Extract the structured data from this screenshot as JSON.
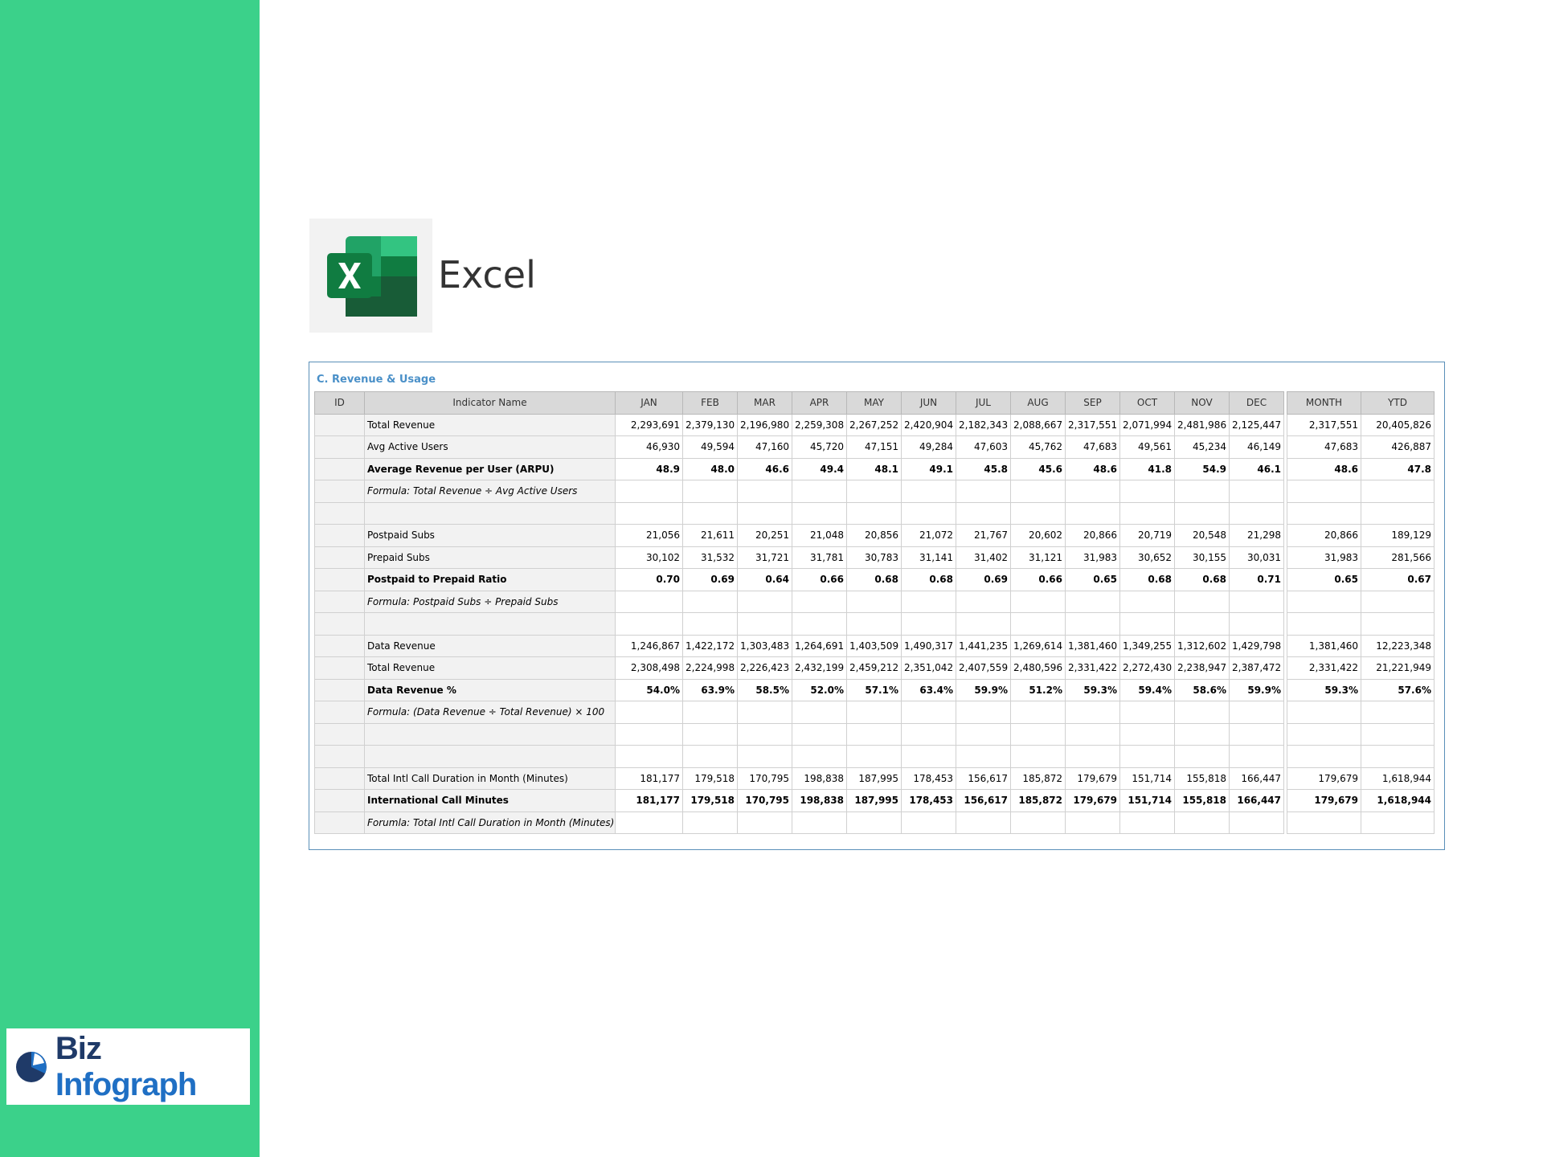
{
  "app": {
    "title": "Excel"
  },
  "brand": {
    "part1": "Biz",
    "part2": "Infograph"
  },
  "colors": {
    "sidebar": "#3bd18a",
    "accent": "#4a90c8",
    "excel_green": "#107c41"
  },
  "sheet": {
    "title": "C. Revenue & Usage",
    "headers": {
      "id": "ID",
      "name": "Indicator Name",
      "months": [
        "JAN",
        "FEB",
        "MAR",
        "APR",
        "MAY",
        "JUN",
        "JUL",
        "AUG",
        "SEP",
        "OCT",
        "NOV",
        "DEC"
      ],
      "month": "MONTH",
      "ytd": "YTD"
    },
    "rows": [
      {
        "id": "",
        "name": "Total Revenue",
        "style": "normal",
        "values": [
          "2,293,691",
          "2,379,130",
          "2,196,980",
          "2,259,308",
          "2,267,252",
          "2,420,904",
          "2,182,343",
          "2,088,667",
          "2,317,551",
          "2,071,994",
          "2,481,986",
          "2,125,447"
        ],
        "month": "2,317,551",
        "ytd": "20,405,826"
      },
      {
        "id": "",
        "name": "Avg Active Users",
        "style": "normal",
        "values": [
          "46,930",
          "49,594",
          "47,160",
          "45,720",
          "47,151",
          "49,284",
          "47,603",
          "45,762",
          "47,683",
          "49,561",
          "45,234",
          "46,149"
        ],
        "month": "47,683",
        "ytd": "426,887"
      },
      {
        "id": "",
        "name": "Average Revenue per User (ARPU)",
        "style": "bold",
        "values": [
          "48.9",
          "48.0",
          "46.6",
          "49.4",
          "48.1",
          "49.1",
          "45.8",
          "45.6",
          "48.6",
          "41.8",
          "54.9",
          "46.1"
        ],
        "month": "48.6",
        "ytd": "47.8"
      },
      {
        "id": "",
        "name": "Formula: Total Revenue ÷ Avg Active Users",
        "style": "italic",
        "values": [
          "",
          "",
          "",
          "",
          "",
          "",
          "",
          "",
          "",
          "",
          "",
          ""
        ],
        "month": "",
        "ytd": ""
      },
      {
        "id": "",
        "name": "",
        "style": "normal",
        "values": [
          "",
          "",
          "",
          "",
          "",
          "",
          "",
          "",
          "",
          "",
          "",
          ""
        ],
        "month": "",
        "ytd": ""
      },
      {
        "id": "",
        "name": "Postpaid Subs",
        "style": "normal",
        "values": [
          "21,056",
          "21,611",
          "20,251",
          "21,048",
          "20,856",
          "21,072",
          "21,767",
          "20,602",
          "20,866",
          "20,719",
          "20,548",
          "21,298"
        ],
        "month": "20,866",
        "ytd": "189,129"
      },
      {
        "id": "",
        "name": "Prepaid Subs",
        "style": "normal",
        "values": [
          "30,102",
          "31,532",
          "31,721",
          "31,781",
          "30,783",
          "31,141",
          "31,402",
          "31,121",
          "31,983",
          "30,652",
          "30,155",
          "30,031"
        ],
        "month": "31,983",
        "ytd": "281,566"
      },
      {
        "id": "",
        "name": "Postpaid to Prepaid Ratio",
        "style": "bold",
        "values": [
          "0.70",
          "0.69",
          "0.64",
          "0.66",
          "0.68",
          "0.68",
          "0.69",
          "0.66",
          "0.65",
          "0.68",
          "0.68",
          "0.71"
        ],
        "month": "0.65",
        "ytd": "0.67"
      },
      {
        "id": "",
        "name": "Formula: Postpaid Subs ÷ Prepaid Subs",
        "style": "italic",
        "values": [
          "",
          "",
          "",
          "",
          "",
          "",
          "",
          "",
          "",
          "",
          "",
          ""
        ],
        "month": "",
        "ytd": ""
      },
      {
        "id": "",
        "name": "",
        "style": "normal",
        "values": [
          "",
          "",
          "",
          "",
          "",
          "",
          "",
          "",
          "",
          "",
          "",
          ""
        ],
        "month": "",
        "ytd": ""
      },
      {
        "id": "",
        "name": "Data Revenue",
        "style": "normal",
        "values": [
          "1,246,867",
          "1,422,172",
          "1,303,483",
          "1,264,691",
          "1,403,509",
          "1,490,317",
          "1,441,235",
          "1,269,614",
          "1,381,460",
          "1,349,255",
          "1,312,602",
          "1,429,798"
        ],
        "month": "1,381,460",
        "ytd": "12,223,348"
      },
      {
        "id": "",
        "name": "Total Revenue",
        "style": "normal",
        "values": [
          "2,308,498",
          "2,224,998",
          "2,226,423",
          "2,432,199",
          "2,459,212",
          "2,351,042",
          "2,407,559",
          "2,480,596",
          "2,331,422",
          "2,272,430",
          "2,238,947",
          "2,387,472"
        ],
        "month": "2,331,422",
        "ytd": "21,221,949"
      },
      {
        "id": "",
        "name": "Data Revenue %",
        "style": "bold",
        "values": [
          "54.0%",
          "63.9%",
          "58.5%",
          "52.0%",
          "57.1%",
          "63.4%",
          "59.9%",
          "51.2%",
          "59.3%",
          "59.4%",
          "58.6%",
          "59.9%"
        ],
        "month": "59.3%",
        "ytd": "57.6%"
      },
      {
        "id": "",
        "name": "Formula: (Data Revenue ÷ Total Revenue) × 100",
        "style": "italic",
        "values": [
          "",
          "",
          "",
          "",
          "",
          "",
          "",
          "",
          "",
          "",
          "",
          ""
        ],
        "month": "",
        "ytd": ""
      },
      {
        "id": "",
        "name": "",
        "style": "normal",
        "values": [
          "",
          "",
          "",
          "",
          "",
          "",
          "",
          "",
          "",
          "",
          "",
          ""
        ],
        "month": "",
        "ytd": ""
      },
      {
        "id": "",
        "name": "",
        "style": "normal",
        "values": [
          "",
          "",
          "",
          "",
          "",
          "",
          "",
          "",
          "",
          "",
          "",
          ""
        ],
        "month": "",
        "ytd": ""
      },
      {
        "id": "",
        "name": "Total Intl Call Duration in Month (Minutes)",
        "style": "normal",
        "values": [
          "181,177",
          "179,518",
          "170,795",
          "198,838",
          "187,995",
          "178,453",
          "156,617",
          "185,872",
          "179,679",
          "151,714",
          "155,818",
          "166,447"
        ],
        "month": "179,679",
        "ytd": "1,618,944"
      },
      {
        "id": "",
        "name": "International Call Minutes",
        "style": "bold",
        "values": [
          "181,177",
          "179,518",
          "170,795",
          "198,838",
          "187,995",
          "178,453",
          "156,617",
          "185,872",
          "179,679",
          "151,714",
          "155,818",
          "166,447"
        ],
        "month": "179,679",
        "ytd": "1,618,944"
      },
      {
        "id": "",
        "name": "Forumla: Total Intl Call Duration in Month (Minutes)",
        "style": "italic",
        "values": [
          "",
          "",
          "",
          "",
          "",
          "",
          "",
          "",
          "",
          "",
          "",
          ""
        ],
        "month": "",
        "ytd": ""
      }
    ]
  }
}
